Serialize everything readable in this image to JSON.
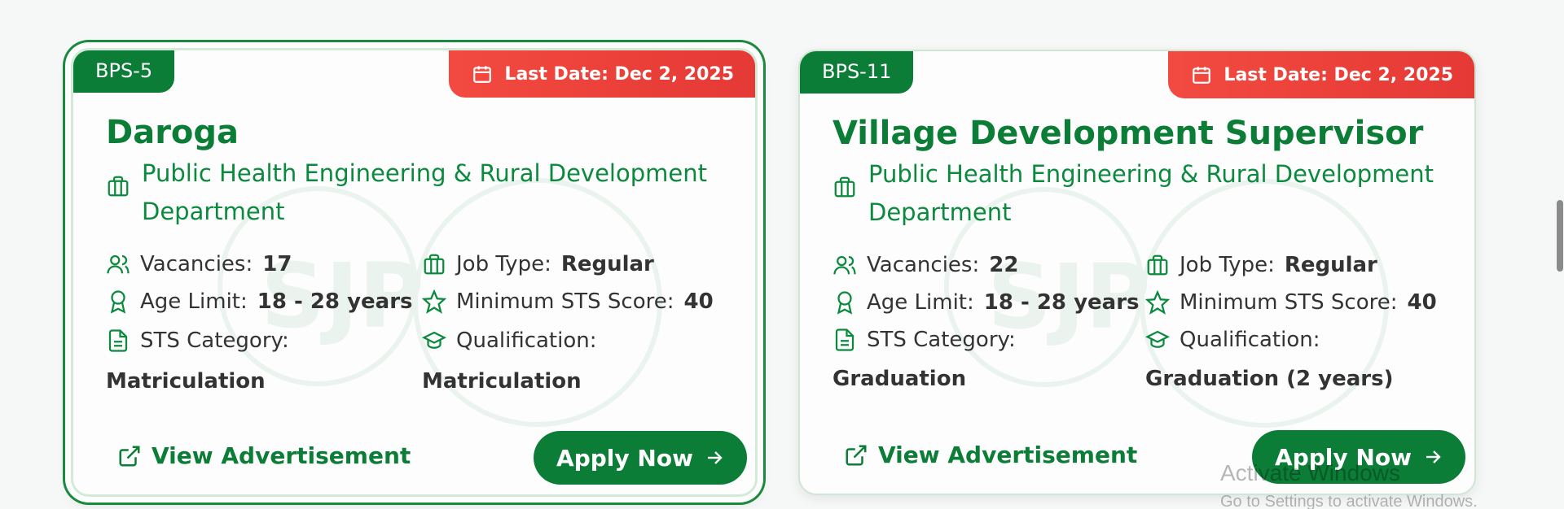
{
  "cards": [
    {
      "bps": "BPS-5",
      "last_date": "Last Date: Dec 2, 2025",
      "title": "Daroga",
      "department": "Public Health Engineering & Rural Development Department",
      "vacancies_label": "Vacancies:",
      "vacancies": "17",
      "job_type_label": "Job Type:",
      "job_type": "Regular",
      "age_label": "Age Limit:",
      "age": "18 - 28 years",
      "sts_score_label": "Minimum STS Score:",
      "sts_score": "40",
      "sts_category_label": "STS Category:",
      "sts_category": "Matriculation",
      "qualification_label": "Qualification:",
      "qualification": "Matriculation",
      "view_label": "View Advertisement",
      "apply_label": "Apply Now"
    },
    {
      "bps": "BPS-11",
      "last_date": "Last Date: Dec 2, 2025",
      "title": "Village Development Supervisor",
      "department": "Public Health Engineering & Rural Development Department",
      "vacancies_label": "Vacancies:",
      "vacancies": "22",
      "job_type_label": "Job Type:",
      "job_type": "Regular",
      "age_label": "Age Limit:",
      "age": "18 - 28 years",
      "sts_score_label": "Minimum STS Score:",
      "sts_score": "40",
      "sts_category_label": "STS Category:",
      "sts_category": "Graduation",
      "qualification_label": "Qualification:",
      "qualification": "Graduation (2 years)",
      "view_label": "View Advertisement",
      "apply_label": "Apply Now"
    }
  ],
  "watermark_text": "SJP",
  "os_notice": {
    "line1": "Activate Windows",
    "line2": "Go to Settings to activate Windows."
  },
  "colors": {
    "primary_green": "#0b7d36",
    "badge_red": "#e53935"
  }
}
